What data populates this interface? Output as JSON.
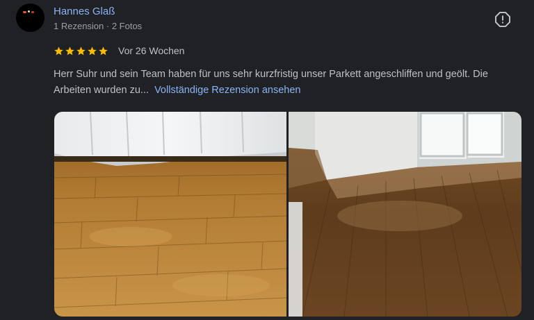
{
  "review": {
    "author": "Hannes Glaß",
    "meta": "1 Rezension · 2 Fotos",
    "rating": 5,
    "date": "Vor 26 Wochen",
    "text": "Herr Suhr und sein Team haben für uns sehr kurzfristig unser Parkett angeschliffen und geölt. Die Arbeiten wurden zu...",
    "more_link": "Vollständige Rezension ansehen"
  },
  "icons": {
    "report": "report-icon",
    "star": "star-icon"
  },
  "colors": {
    "background": "#202124",
    "link": "#8ab4f8",
    "star": "#fbbc04",
    "text": "#bdc1c6",
    "muted": "#9aa0a6"
  },
  "photos": [
    {
      "name": "photo-1"
    },
    {
      "name": "photo-2"
    }
  ]
}
